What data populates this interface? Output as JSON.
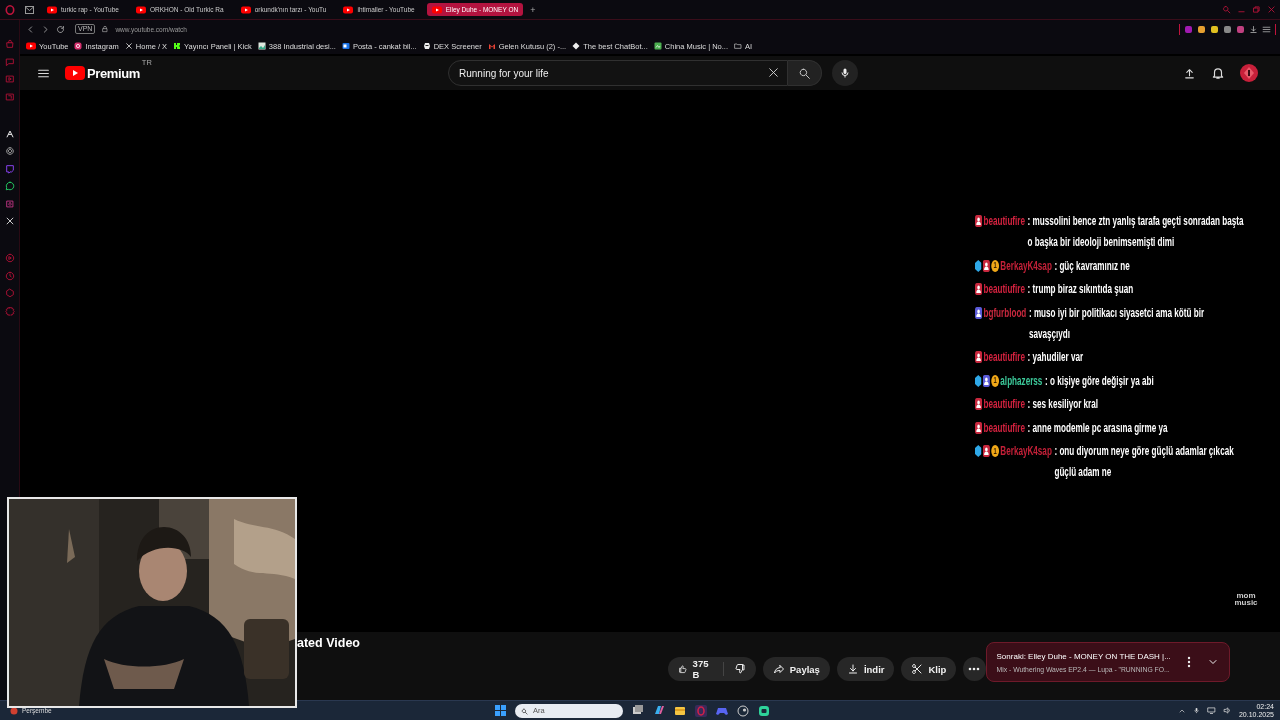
{
  "browser": {
    "tabs": [
      {
        "title": "turkic rap - YouTube",
        "selected": false
      },
      {
        "title": "ORKHON - Old Turkic Ra",
        "selected": false
      },
      {
        "title": "orkundk'nın tarzı - YouTu",
        "selected": false
      },
      {
        "title": "ihtimaller - YouTube",
        "selected": false
      },
      {
        "title": "Elley Duhe - MONEY ON",
        "selected": true
      }
    ],
    "new_tab": "+",
    "address": {
      "vpn": "VPN",
      "url": "www.youtube.com/watch"
    },
    "bookmarks": [
      "YouTube",
      "Instagram",
      "Home / X",
      "Yayıncı Paneli | Kick",
      "388 Industrial desi...",
      "Posta - cankat bil...",
      "DEX Screener",
      "Gelen Kutusu (2) -...",
      "The best ChatBot...",
      "China Music | No...",
      "AI"
    ]
  },
  "youtube": {
    "logo": "Premium",
    "region": "TR",
    "search": {
      "value": "Running for your life"
    },
    "video": {
      "chat": [
        {
          "user": "beautiufire",
          "color": "#d3223f",
          "badges": [
            {
              "kind": "role",
              "color": "#c8283e"
            }
          ],
          "text": ": mussolini bence ztn yanlış tarafa geçti sonradan başta o başka bir ideoloji benimsemişti dimi"
        },
        {
          "user": "BerkayK4sap",
          "color": "#c42038",
          "badges": [
            {
              "kind": "gem"
            },
            {
              "kind": "role",
              "color": "#c8283e"
            },
            {
              "kind": "coin",
              "text": "1"
            }
          ],
          "text": ": güç kavramınız ne"
        },
        {
          "user": "beautiufire",
          "color": "#d3223f",
          "badges": [
            {
              "kind": "role",
              "color": "#c8283e"
            }
          ],
          "text": ": trump biraz sıkıntıda şuan"
        },
        {
          "user": "bgfurblood",
          "color": "#c8283e",
          "badges": [
            {
              "kind": "role",
              "color": "#5a5ad8"
            }
          ],
          "text": ": muso iyi bir politikacı siyasetci ama kötü bir savaşçıydı"
        },
        {
          "user": "beautiufire",
          "color": "#d3223f",
          "badges": [
            {
              "kind": "role",
              "color": "#c8283e"
            }
          ],
          "text": ": yahudiler var"
        },
        {
          "user": "alphazerss",
          "color": "#3cc99a",
          "badges": [
            {
              "kind": "gem"
            },
            {
              "kind": "role",
              "color": "#5a5ad8"
            },
            {
              "kind": "coin",
              "text": "1"
            }
          ],
          "text": ": o kişiye göre değişir ya abi"
        },
        {
          "user": "beautiufire",
          "color": "#d3223f",
          "badges": [
            {
              "kind": "role",
              "color": "#c8283e"
            }
          ],
          "text": ": ses kesiliyor kral"
        },
        {
          "user": "beautiufire",
          "color": "#d3223f",
          "badges": [
            {
              "kind": "role",
              "color": "#c8283e"
            }
          ],
          "text": ": anne modemle pc arasına girme ya"
        },
        {
          "user": "BerkayK4sap",
          "color": "#c42038",
          "badges": [
            {
              "kind": "gem"
            },
            {
              "kind": "role",
              "color": "#c8283e"
            },
            {
              "kind": "coin",
              "text": "1"
            }
          ],
          "text": ": onu diyorum neye göre güçlü adamlar çıkcak güçlü adam ne"
        }
      ],
      "logo": "mom music"
    },
    "title": "ated Video",
    "actions": {
      "likes": "375 B",
      "share": "Paylaş",
      "download": "İndir",
      "clip": "Klip"
    },
    "next_up": {
      "title": "Sonraki: Elley Duhe - MONEY ON THE DASH |...",
      "subtitle": "Mix - Wuthering Waves EP2.4 — Lupa - \"RUNNING FO..."
    }
  },
  "taskbar": {
    "day": "Perşembe",
    "search": {
      "placeholder": "Ara"
    },
    "time": "02:24",
    "date": "20.10.2025"
  }
}
